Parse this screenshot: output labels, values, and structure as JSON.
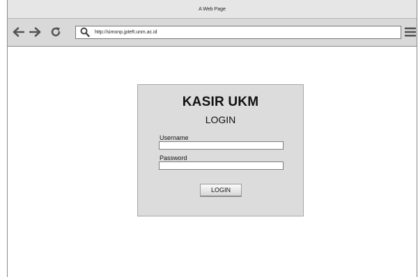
{
  "window": {
    "title": "A Web Page"
  },
  "toolbar": {
    "back_icon": "arrow-left-icon",
    "forward_icon": "arrow-right-icon",
    "reload_icon": "reload-icon",
    "search_icon": "search-icon",
    "menu_icon": "hamburger-menu-icon",
    "url": "http://simonp.jpteft.unm.ac.id"
  },
  "login": {
    "title": "KASIR UKM",
    "subtitle": "LOGIN",
    "username_label": "Username",
    "username_value": "",
    "password_label": "Password",
    "password_value": "",
    "submit_label": "LOGIN"
  }
}
